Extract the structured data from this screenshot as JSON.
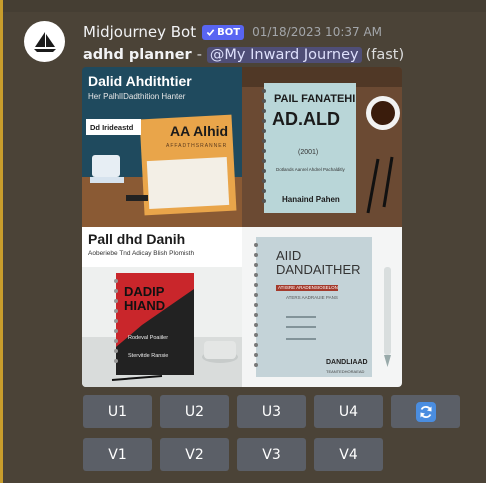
{
  "message": {
    "username": "Midjourney Bot",
    "badge": "BOT",
    "timestamp": "01/18/2023 10:37 AM",
    "prompt": "adhd planner",
    "separator": "-",
    "mention": "@My Inward Journey",
    "mode": "(fast)"
  },
  "image": {
    "tiles": [
      {
        "title": "Dalid Ahdithtier",
        "subtitle": "Her PalhlIDadthition Hanter",
        "label": "Dd Irideastd",
        "card_title": "AA Alhid",
        "card_sub": "AFFADTHSRANNER"
      },
      {
        "title": "PAIL FANATEHI",
        "big": "AD.ALD",
        "year": "(2001)",
        "line": "Dotlands Aanrel Ahdrel Pachalditly",
        "author": "Hanaind Pahen"
      },
      {
        "title": "Pall dhd Danih",
        "subtitle": "Aoberiebe Tnd Adicay Blish Plomisth",
        "cover": "DADIP HIAND",
        "cover_small": "Rodeval Poaiiler",
        "cover_small2": "Stervitde Ransie"
      },
      {
        "title": "AIID DANDAITHER",
        "tag": "ATIISRE ARADENSIOSELON",
        "sub": "ATERS AADRAUIE PANS",
        "footer": "DANDLIAAD",
        "footer_sub": "TEANTEDHORAEAD"
      }
    ]
  },
  "buttons": {
    "row1": [
      "U1",
      "U2",
      "U3",
      "U4"
    ],
    "row2": [
      "V1",
      "V2",
      "V3",
      "V4"
    ],
    "refresh_icon": "refresh-icon"
  },
  "colors": {
    "background": "#4b4337",
    "highlight_bar": "#c89d2c",
    "button": "#5b5f67",
    "badge": "#5865f2",
    "mention_bg": "#5865f2"
  }
}
